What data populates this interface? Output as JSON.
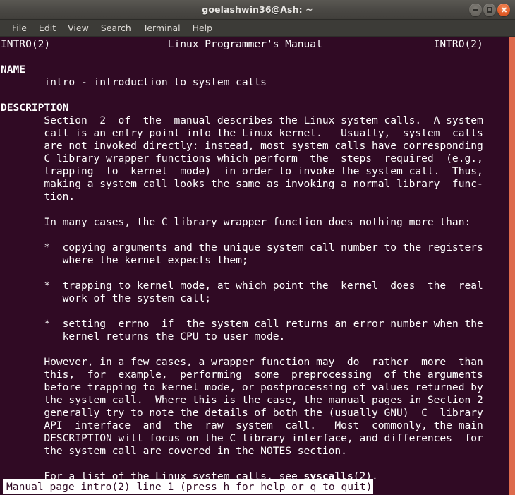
{
  "window": {
    "title": "goelashwin36@Ash: ~",
    "controls": [
      {
        "name": "minimize",
        "glyph": "dash"
      },
      {
        "name": "maximize",
        "glyph": "square"
      },
      {
        "name": "close",
        "glyph": "x"
      }
    ]
  },
  "menu": {
    "items": [
      "File",
      "Edit",
      "View",
      "Search",
      "Terminal",
      "Help"
    ]
  },
  "colors": {
    "terminal_background": "#300a24",
    "terminal_foreground": "#ffffff",
    "titlebar": "#4b4945",
    "menubar": "#3c3b37",
    "scrollbar": "#dd6a4c",
    "close_button": "#e35f2b",
    "status_background": "#ffffff",
    "status_foreground": "#300a24"
  },
  "terminal": {
    "man_header": {
      "left": "INTRO(2)",
      "center": "Linux Programmer's Manual",
      "right": "INTRO(2)"
    },
    "lines": [
      "INTRO(2)                   Linux Programmer's Manual                  INTRO(2)",
      "",
      "NAME",
      "       intro - introduction to system calls",
      "",
      "DESCRIPTION",
      "       Section  2  of  the  manual describes the Linux system calls.  A system",
      "       call is an entry point into the Linux kernel.   Usually,  system  calls",
      "       are not invoked directly: instead, most system calls have corresponding",
      "       C library wrapper functions which perform  the  steps  required  (e.g.,",
      "       trapping  to  kernel  mode)  in order to invoke the system call.  Thus,",
      "       making a system call looks the same as invoking a normal library  func-",
      "       tion.",
      "",
      "       In many cases, the C library wrapper function does nothing more than:",
      "",
      "       *  copying arguments and the unique system call number to the registers",
      "          where the kernel expects them;",
      "",
      "       *  trapping to kernel mode, at which point the  kernel  does  the  real",
      "          work of the system call;",
      "",
      "       *  setting  errno  if  the system call returns an error number when the",
      "          kernel returns the CPU to user mode.",
      "",
      "       However, in a few cases, a wrapper function may  do  rather  more  than",
      "       this,  for  example,  performing  some  preprocessing  of the arguments",
      "       before trapping to kernel mode, or postprocessing of values returned by",
      "       the system call.  Where this is the case, the manual pages in Section 2",
      "       generally try to note the details of both the (usually GNU)  C  library",
      "       API  interface  and  the  raw  system  call.   Most  commonly, the main",
      "       DESCRIPTION will focus on the C library interface, and differences  for",
      "       the system call are covered in the NOTES section.",
      "",
      "       For a list of the Linux system calls, see syscalls(2)."
    ],
    "emphasis": {
      "section_headings": [
        "NAME",
        "DESCRIPTION"
      ],
      "underlined": [
        "errno"
      ],
      "bold_inline": [
        "syscalls"
      ]
    },
    "status": "Manual page intro(2) line 1 (press h for help or q to quit)"
  }
}
